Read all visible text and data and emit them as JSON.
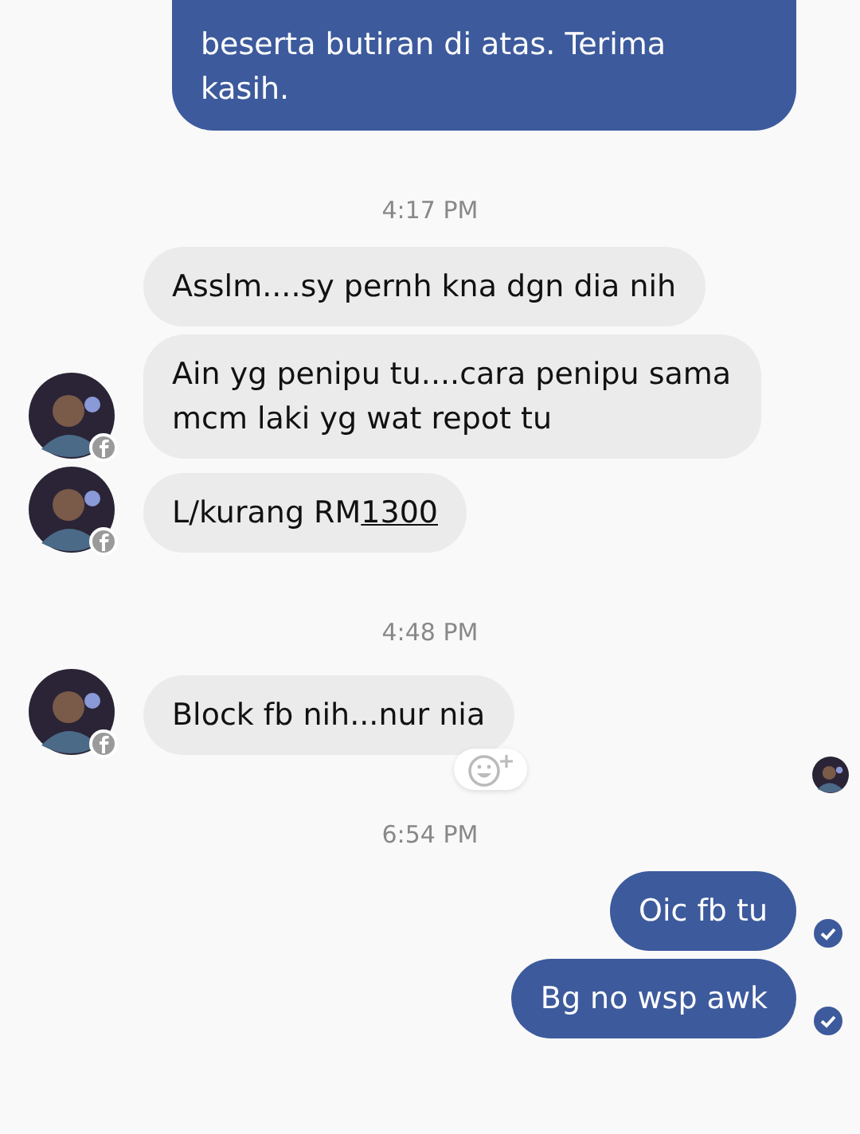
{
  "thread": [
    {
      "kind": "out",
      "text": "beserta butiran di atas. Terima kasih.",
      "delivered": false,
      "cut_top": true
    },
    {
      "kind": "time",
      "text": "4:17 PM"
    },
    {
      "kind": "in",
      "parts": [
        {
          "text": "Asslm....sy pernh kna dgn dia nih"
        }
      ],
      "avatar": false
    },
    {
      "kind": "in",
      "parts": [
        {
          "text": "Ain yg penipu tu....cara penipu sama mcm laki yg wat repot tu"
        }
      ],
      "avatar": true
    },
    {
      "kind": "in",
      "parts": [
        {
          "text": "L/kurang RM"
        },
        {
          "text": "1300",
          "link": true
        }
      ],
      "avatar": true
    },
    {
      "kind": "time",
      "text": "4:48 PM"
    },
    {
      "kind": "in",
      "parts": [
        {
          "text": "Block fb nih...nur nia"
        }
      ],
      "avatar": true,
      "reaction_button": true,
      "seen": true
    },
    {
      "kind": "time",
      "text": "6:54 PM"
    },
    {
      "kind": "out",
      "text": "Oic fb tu",
      "delivered": true
    },
    {
      "kind": "out",
      "text": "Bg no wsp awk",
      "delivered": true
    }
  ]
}
